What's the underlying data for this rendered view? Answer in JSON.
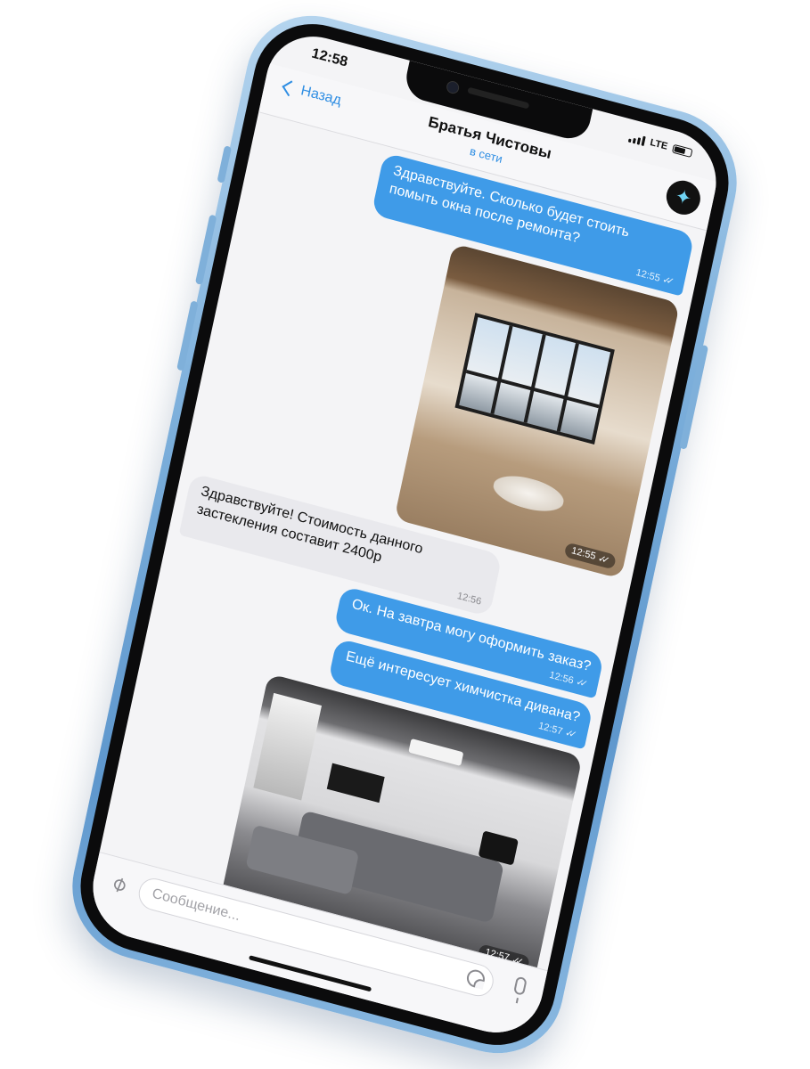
{
  "status_bar": {
    "time": "12:58",
    "network": "LTE"
  },
  "header": {
    "back_label": "Назад",
    "title": "Братья Чистовы",
    "status": "в сети",
    "avatar_icon": "sparkle-icon"
  },
  "messages": [
    {
      "direction": "out",
      "type": "text",
      "text": "Здравствуйте. Сколько будет стоить помыть окна после ремонта?",
      "time": "12:55",
      "read": true
    },
    {
      "direction": "out",
      "type": "photo",
      "description_icon": "room-photo",
      "time": "12:55",
      "read": true
    },
    {
      "direction": "in",
      "type": "text",
      "text": "Здравствуйте! Стоимость данного застекления составит 2400р",
      "time": "12:56"
    },
    {
      "direction": "out",
      "type": "text",
      "text": "Ок. На завтра могу оформить заказ?",
      "time": "12:56",
      "read": true
    },
    {
      "direction": "out",
      "type": "text",
      "text": "Ещё интересует химчистка дивана?",
      "time": "12:57",
      "read": true
    },
    {
      "direction": "out",
      "type": "photo",
      "description_icon": "sofa-photo",
      "time": "12:57",
      "read": true
    }
  ],
  "composer": {
    "placeholder": "Сообщение...",
    "attach_icon": "paperclip-icon",
    "sticker_icon": "sticker-icon",
    "mic_icon": "microphone-icon"
  },
  "colors": {
    "accent": "#2f8ee3",
    "outgoing_bubble": "#3f9be8",
    "incoming_bubble": "#e9e9ed",
    "phone_frame": "#7fb1dc"
  }
}
